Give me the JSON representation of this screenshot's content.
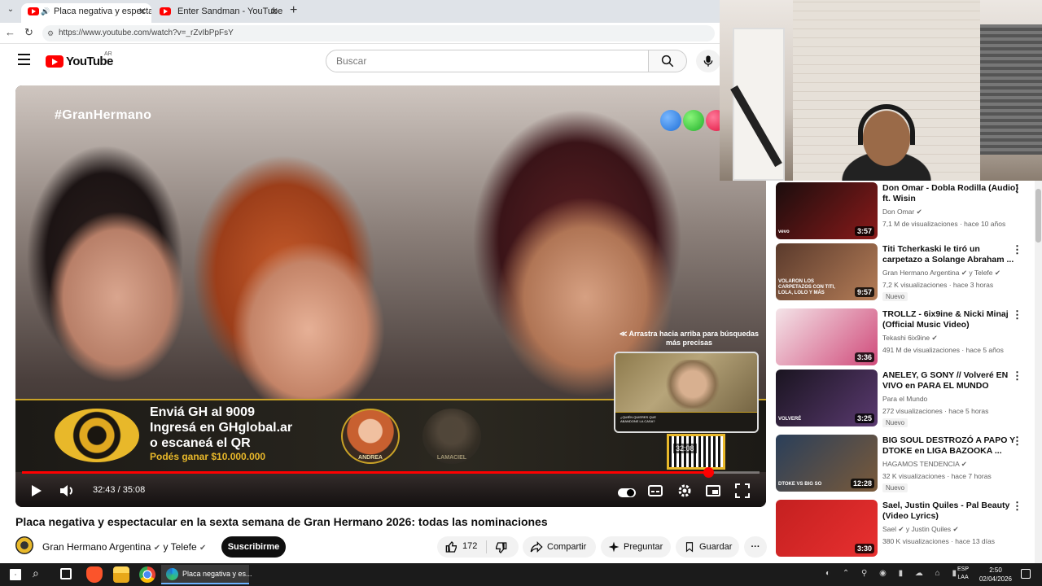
{
  "browser": {
    "tabs": [
      {
        "title": "Placa negativa y espectacular",
        "active": true
      },
      {
        "title": "Enter Sandman - YouTube",
        "active": false
      }
    ],
    "new_tab": "+",
    "url": "https://www.youtube.com/watch?v=_rZvIbPpFsY"
  },
  "masthead": {
    "logo_text": "YouTube",
    "country": "AR",
    "search_placeholder": "Buscar"
  },
  "video": {
    "hashtag": "#GranHermano",
    "banner_line1": "Enviá GH al 9009",
    "banner_line2": "Ingresá en GHglobal.ar",
    "banner_line3": "o escaneá el QR",
    "banner_prize": "Podés ganar $10.000.000",
    "face1_label": "ANDREA",
    "face2_label": "LAMACIEL",
    "hint": "≪ Arrastra hacia arriba para búsquedas más precisas",
    "pip_caption": "¿QUIÉN QUIERES QUE ABANDONE LA CASA?",
    "qr_time": "32:08",
    "time": "32:43 / 35:08",
    "progress_fraction": 0.931,
    "title": "Placa negativa y espectacular en la sexta semana de Gran Hermano 2026: todas las nominaciones",
    "channel": "Gran Hermano Argentina",
    "channel_join": "y Telefe",
    "subscribe": "Suscribirme",
    "likes": "172",
    "share": "Compartir",
    "ask": "Preguntar",
    "save": "Guardar",
    "more": "···"
  },
  "sidebar": [
    {
      "title": "Don Omar - Dobla Rodilla (Audio) ft. Wisin",
      "channel": "Don Omar",
      "verified": true,
      "meta": "7,1 M de visualizaciones · hace 10 años",
      "duration": "3:57",
      "new": "",
      "thumb": [
        "#1a0d0d",
        "#8a1a1a"
      ],
      "overlay": "vevo"
    },
    {
      "title": "Titi Tcherkaski le tiró un carpetazo a Solange Abraham ...",
      "channel": "Gran Hermano Argentina",
      "channel2": "y Telefe",
      "verified": true,
      "meta": "7,2 K visualizaciones · hace 3 horas",
      "duration": "9:57",
      "new": "Nuevo",
      "thumb": [
        "#5a3a2c",
        "#b57d57"
      ],
      "overlay": "VOLARON LOS CARPETAZOS CON TITI, LOLA, LOLO Y MÁS"
    },
    {
      "title": "TROLLZ - 6ix9ine & Nicki Minaj (Official Music Video)",
      "channel": "Tekashi 6ix9ine",
      "verified": true,
      "meta": "491 M de visualizaciones · hace 5 años",
      "duration": "3:36",
      "new": "",
      "thumb": [
        "#f4e4e8",
        "#d04a7a"
      ],
      "overlay": ""
    },
    {
      "title": "ANELEY, G SONY // Volveré EN VIVO en PARA EL MUNDO",
      "channel": "Para el Mundo",
      "verified": false,
      "meta": "272 visualizaciones · hace 5 horas",
      "duration": "3:25",
      "new": "Nuevo",
      "thumb": [
        "#1a1420",
        "#5a3a70"
      ],
      "overlay": "VOLVERÉ"
    },
    {
      "title": "BIG SOUL DESTROZÓ A PAPO Y DTOKE en LIGA BAZOOKA ...",
      "channel": "HAGAMOS TENDENCIA",
      "verified": true,
      "meta": "32 K visualizaciones · hace 7 horas",
      "duration": "12:28",
      "new": "Nuevo",
      "thumb": [
        "#2a3f5a",
        "#7a5a3a"
      ],
      "overlay": "DTOKE VS BIG SO"
    },
    {
      "title": "Sael, Justin Quiles - Pal Beauty (Video Lyrics)",
      "channel": "Sael",
      "channel2": "y Justin Quiles",
      "verified": true,
      "meta": "380 K visualizaciones · hace 13 días",
      "duration": "3:30",
      "new": "",
      "thumb": [
        "#c42020",
        "#e83030"
      ],
      "overlay": ""
    }
  ],
  "taskbar": {
    "active_app": "Placa negativa y es...",
    "lang1": "ESP",
    "lang2": "LAA",
    "time": "2:50",
    "date": "02/04/2026"
  },
  "colors": {
    "accent": "#ff0000",
    "gold": "#e8b82a"
  }
}
